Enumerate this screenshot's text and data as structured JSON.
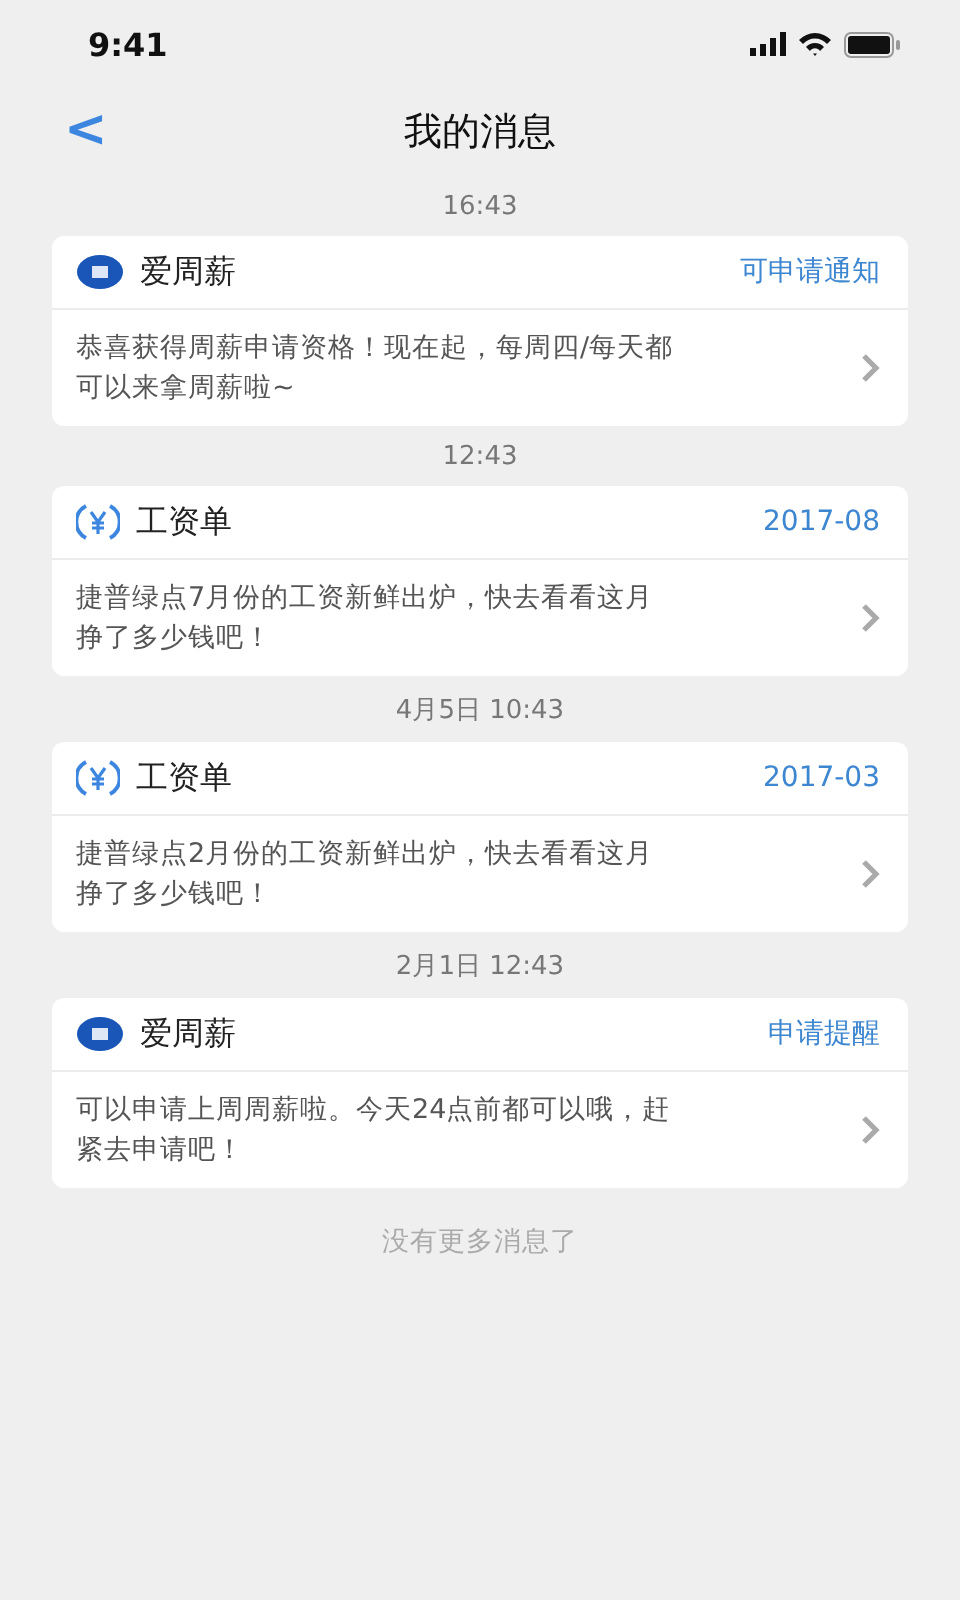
{
  "status_bar": {
    "time": "9:41"
  },
  "header": {
    "back": "<",
    "title": "我的消息"
  },
  "messages": [
    {
      "time": "16:43",
      "kind": "app",
      "source": "爱周薪",
      "tag": "可申请通知",
      "body": "恭喜获得周薪申请资格！现在起，每周四/每天都可以来拿周薪啦~"
    },
    {
      "time": "12:43",
      "kind": "payslip",
      "source": "工资单",
      "tag": "2017-08",
      "body": "捷普绿点7月份的工资新鲜出炉，快去看看这月挣了多少钱吧！"
    },
    {
      "time": "4月5日  10:43",
      "kind": "payslip",
      "source": "工资单",
      "tag": "2017-03",
      "body": "捷普绿点2月份的工资新鲜出炉，快去看看这月挣了多少钱吧！"
    },
    {
      "time": "2月1日  12:43",
      "kind": "app",
      "source": "爱周薪",
      "tag": "申请提醒",
      "body": "可以申请上周周薪啦。今天24点前都可以哦，赶紧去申请吧！"
    }
  ],
  "footer": "没有更多消息了"
}
